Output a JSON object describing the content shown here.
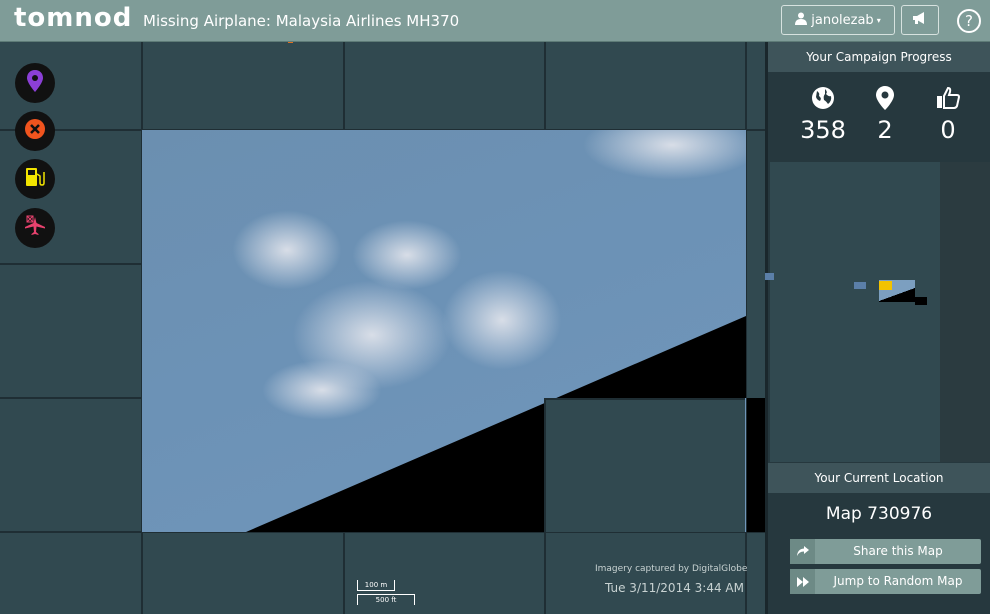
{
  "header": {
    "logo": "tomnod",
    "title": "Missing Airplane: Malaysia Airlines MH370",
    "user": "janolezab",
    "help": "?"
  },
  "tools": [
    {
      "name": "marker",
      "color": "#8b3fd6"
    },
    {
      "name": "close",
      "color": "#f0541e"
    },
    {
      "name": "fuel",
      "color": "#f2e400"
    },
    {
      "name": "airplane",
      "color": "#e8426e"
    }
  ],
  "map": {
    "credit": "Imagery captured by DigitalGlobe",
    "timestamp": "Tue 3/11/2014 3:44 AM",
    "scale_metric": "100 m",
    "scale_imperial": "500 ft"
  },
  "progress": {
    "heading": "Your Campaign Progress",
    "maps_viewed": "358",
    "tags": "2",
    "likes": "0"
  },
  "location": {
    "heading": "Your Current Location",
    "map_label": "Map 730976",
    "share_label": "Share this Map",
    "jump_label": "Jump to Random Map"
  },
  "colors": {
    "header_bg": "#7f9c98",
    "panel_bg": "#26383e",
    "map_bg": "#314950",
    "minimap_highlight": "#f2c200"
  }
}
